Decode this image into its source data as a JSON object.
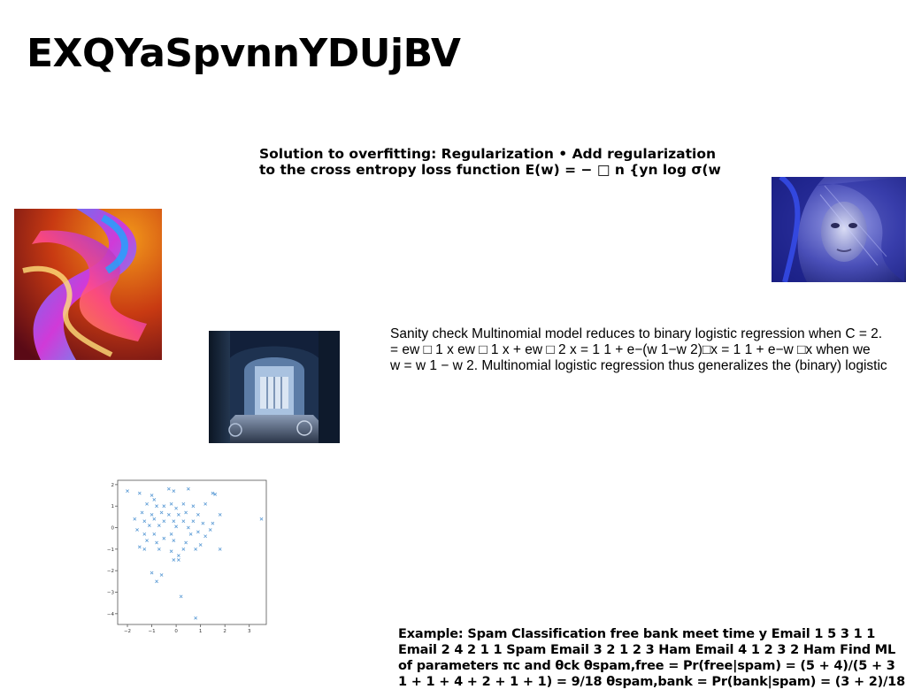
{
  "slide": {
    "title": "EXQYaSpvnnYDUjBV",
    "paragraph_top": [
      "Solution to overfitting: Regularization • Add regularization",
      "to the cross entropy loss function E(w) = − □ n {yn log σ(w"
    ],
    "paragraph_middle": [
      "Sanity check Multinomial model reduces to binary logistic regression when C = 2.",
      "= ew □ 1 x ew □ 1 x + ew □ 2 x = 1 1 + e−(w 1−w 2)□x = 1 1 + e−w □x when we",
      "w = w 1 − w 2. Multinomial logistic regression thus generalizes the (binary) logistic"
    ],
    "paragraph_bottom": [
      "Example: Spam Classification free bank meet time y Email 1 5 3 1 1",
      "Email 2 4 2 1 1 Spam Email 3 2 1 2 3 Ham Email 4 1 2 3 2 Ham Find ML",
      "of parameters πc and θck θspam,free = Pr(free|spam) = (5 + 4)/(5 + 3",
      "1 + 1 + 4 + 2 + 1 + 1) = 9/18 θspam,bank = Pr(bank|spam) = (3 + 2)/18 ="
    ]
  },
  "images": {
    "abstract": "abstract-swirl-image",
    "portrait": "blue-veiled-face-image",
    "alley": "blue-alley-photo"
  },
  "chart_data": {
    "type": "scatter",
    "marker": "x",
    "color": "#5b9bd5",
    "xticks": [
      "−2",
      "−1",
      "0",
      "1",
      "2",
      "3"
    ],
    "yticks": [
      "2",
      "1",
      "0",
      "−1",
      "−2",
      "−3",
      "−4"
    ],
    "xlim": [
      -2.4,
      3.7
    ],
    "ylim": [
      -4.5,
      2.2
    ],
    "points": [
      [
        -2.0,
        1.7
      ],
      [
        -1.5,
        1.6
      ],
      [
        -1.0,
        1.5
      ],
      [
        -0.9,
        1.3
      ],
      [
        -0.3,
        1.8
      ],
      [
        -0.1,
        1.7
      ],
      [
        0.5,
        1.8
      ],
      [
        1.5,
        1.6
      ],
      [
        1.6,
        1.55
      ],
      [
        -1.2,
        1.1
      ],
      [
        -0.8,
        1.0
      ],
      [
        -0.5,
        1.0
      ],
      [
        -0.2,
        1.1
      ],
      [
        0.3,
        1.1
      ],
      [
        0.7,
        1.0
      ],
      [
        1.2,
        1.1
      ],
      [
        0.0,
        0.9
      ],
      [
        -1.4,
        0.7
      ],
      [
        -1.0,
        0.6
      ],
      [
        -0.6,
        0.7
      ],
      [
        -0.3,
        0.6
      ],
      [
        0.1,
        0.6
      ],
      [
        0.4,
        0.7
      ],
      [
        0.9,
        0.6
      ],
      [
        1.8,
        0.6
      ],
      [
        3.5,
        0.4
      ],
      [
        -1.7,
        0.4
      ],
      [
        -1.3,
        0.3
      ],
      [
        -0.9,
        0.4
      ],
      [
        -0.5,
        0.3
      ],
      [
        -0.1,
        0.3
      ],
      [
        0.3,
        0.3
      ],
      [
        0.7,
        0.3
      ],
      [
        1.1,
        0.2
      ],
      [
        1.5,
        0.2
      ],
      [
        -1.1,
        0.1
      ],
      [
        -0.7,
        0.1
      ],
      [
        0.0,
        0.05
      ],
      [
        0.5,
        0.0
      ],
      [
        1.4,
        -0.1
      ],
      [
        -1.6,
        -0.1
      ],
      [
        -1.3,
        -0.3
      ],
      [
        -0.9,
        -0.3
      ],
      [
        -0.2,
        -0.3
      ],
      [
        0.6,
        -0.3
      ],
      [
        0.9,
        -0.2
      ],
      [
        1.2,
        -0.4
      ],
      [
        -0.5,
        -0.5
      ],
      [
        -1.2,
        -0.6
      ],
      [
        -0.8,
        -0.7
      ],
      [
        -0.1,
        -0.6
      ],
      [
        0.4,
        -0.7
      ],
      [
        1.0,
        -0.8
      ],
      [
        -1.5,
        -0.9
      ],
      [
        -1.3,
        -1.0
      ],
      [
        -0.7,
        -1.0
      ],
      [
        -0.2,
        -1.1
      ],
      [
        0.3,
        -1.0
      ],
      [
        0.8,
        -1.0
      ],
      [
        1.8,
        -1.0
      ],
      [
        0.1,
        -1.3
      ],
      [
        -0.1,
        -1.5
      ],
      [
        0.1,
        -1.5
      ],
      [
        -1.0,
        -2.1
      ],
      [
        -0.6,
        -2.2
      ],
      [
        -0.8,
        -2.5
      ],
      [
        0.2,
        -3.2
      ],
      [
        0.8,
        -4.2
      ]
    ]
  }
}
